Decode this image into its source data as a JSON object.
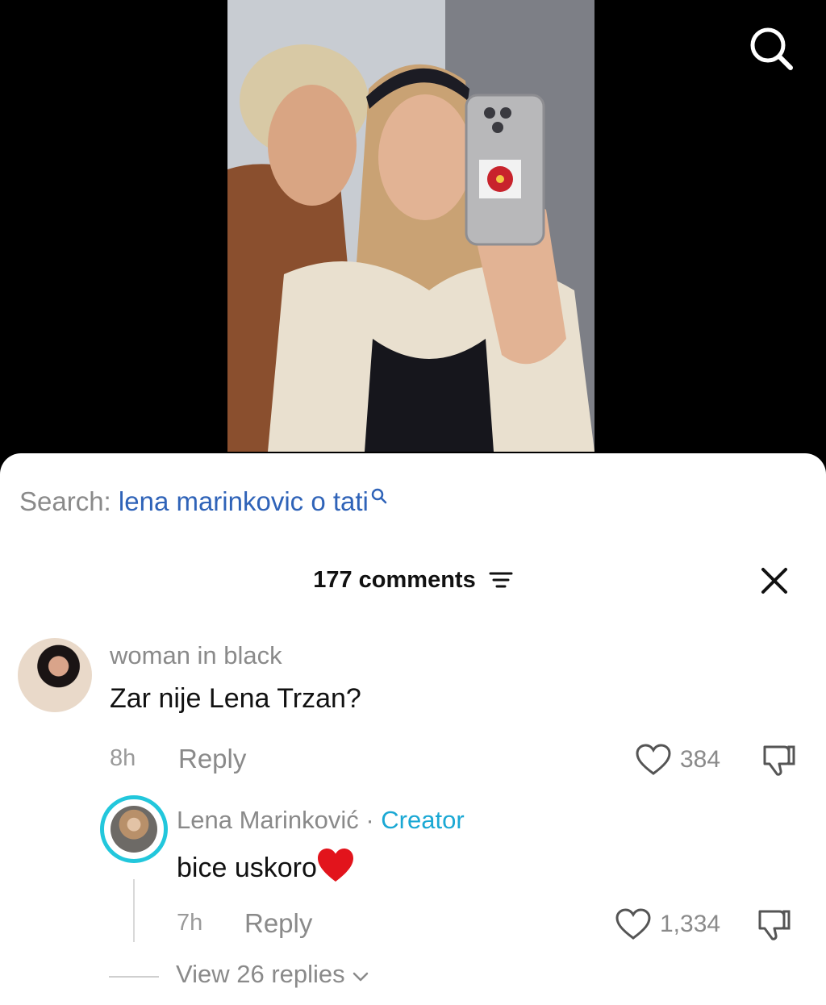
{
  "video": {
    "search_icon": "search-icon"
  },
  "sheet": {
    "search_prefix": "Search:",
    "search_query": "lena marinkovic o tati",
    "comments_count": "177 comments",
    "filter_icon": "filter-icon",
    "close_icon": "close-icon"
  },
  "comments": [
    {
      "username": "woman in black",
      "text": "Zar nije Lena Trzan?",
      "time": "8h",
      "reply_label": "Reply",
      "likes": "384"
    }
  ],
  "reply": {
    "username": "Lena Marinković",
    "separator": "·",
    "badge": "Creator",
    "text": "bice uskoro",
    "emoji": "❤️",
    "time": "7h",
    "reply_label": "Reply",
    "likes": "1,334"
  },
  "view_replies": "View 26 replies",
  "colors": {
    "link_blue": "#2f63b8",
    "creator_badge": "#1aa8d4",
    "ring": "#22c7dc",
    "heart_red": "#e2141c"
  }
}
